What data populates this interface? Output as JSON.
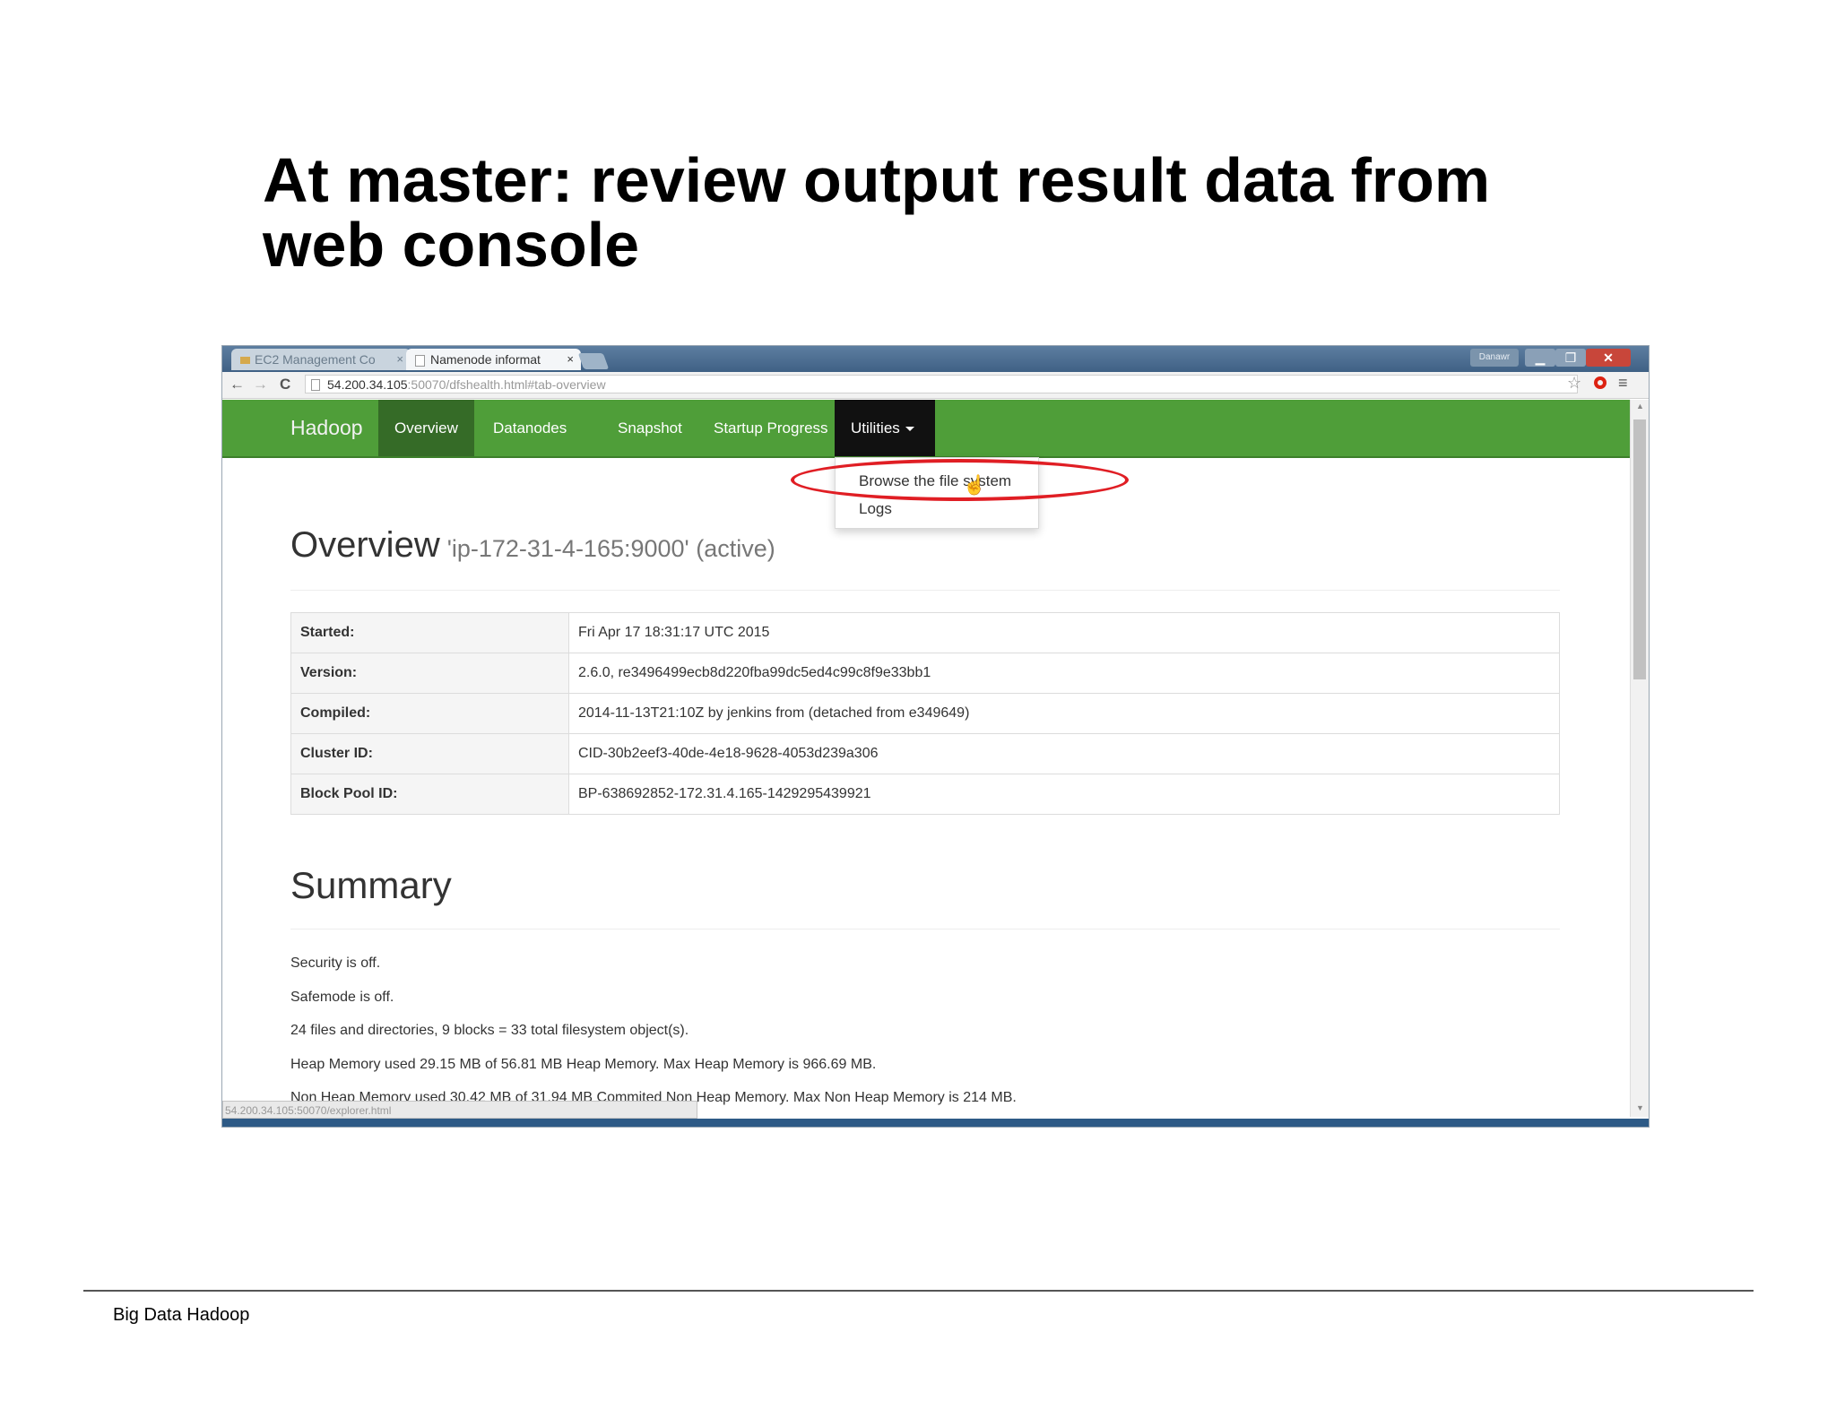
{
  "slide": {
    "title_line1": "At master: review output result data from",
    "title_line2": "web console",
    "footer": "Big Data Hadoop"
  },
  "browser": {
    "tabs": [
      {
        "label": "EC2 Management Co",
        "active": false
      },
      {
        "label": "Namenode informat",
        "active": true
      }
    ],
    "user_badge": "Danawr",
    "url_host": "54.200.34.105",
    "url_rest": ":50070/dfshealth.html#tab-overview",
    "status_url": "54.200.34.105:50070/explorer.html"
  },
  "navbar": {
    "brand": "Hadoop",
    "items": [
      "Overview",
      "Datanodes",
      "Snapshot",
      "Startup Progress",
      "Utilities"
    ]
  },
  "dropdown": {
    "items": [
      "Browse the file system",
      "Logs"
    ]
  },
  "overview": {
    "heading": "Overview",
    "subheading": "'ip-172-31-4-165:9000' (active)",
    "rows": [
      {
        "key": "Started:",
        "value": "Fri Apr 17 18:31:17 UTC 2015"
      },
      {
        "key": "Version:",
        "value": "2.6.0, re3496499ecb8d220fba99dc5ed4c99c8f9e33bb1"
      },
      {
        "key": "Compiled:",
        "value": "2014-11-13T21:10Z by jenkins from (detached from e349649)"
      },
      {
        "key": "Cluster ID:",
        "value": "CID-30b2eef3-40de-4e18-9628-4053d239a306"
      },
      {
        "key": "Block Pool ID:",
        "value": "BP-638692852-172.31.4.165-1429295439921"
      }
    ]
  },
  "summary": {
    "heading": "Summary",
    "lines": [
      "Security is off.",
      "Safemode is off.",
      "24 files and directories, 9 blocks = 33 total filesystem object(s).",
      "Heap Memory used 29.15 MB of 56.81 MB Heap Memory. Max Heap Memory is 966.69 MB.",
      "Non Heap Memory used 30.42 MB of 31.94 MB Commited Non Heap Memory. Max Non Heap Memory is 214 MB."
    ]
  },
  "colors": {
    "navbar_green": "#4f9e39",
    "highlight_red": "#e01e24"
  }
}
